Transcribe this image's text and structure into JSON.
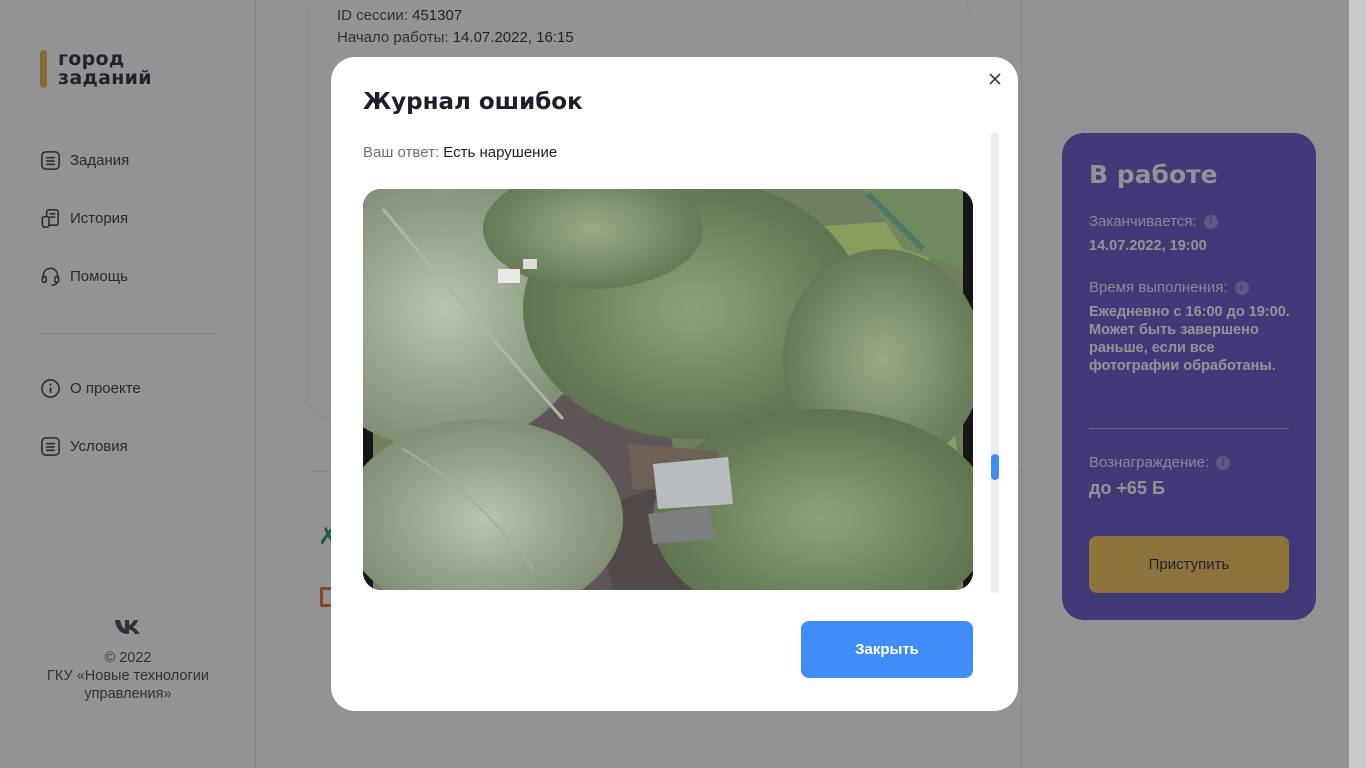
{
  "brand": {
    "logo_line1": "город",
    "logo_line2": "заданий",
    "accent": "#e0b23f"
  },
  "sidebar": {
    "items": [
      {
        "label": "Задания",
        "icon": "list-icon"
      },
      {
        "label": "История",
        "icon": "history-icon"
      },
      {
        "label": "Помощь",
        "icon": "headset-icon"
      },
      {
        "label": "О проекте",
        "icon": "info-icon"
      },
      {
        "label": "Условия",
        "icon": "list-icon"
      }
    ],
    "footer": {
      "copyright": "© 2022",
      "org_line1": "ГКУ «Новые технологии",
      "org_line2": "управления»",
      "social_icon": "vk-icon"
    }
  },
  "session": {
    "id_label": "ID сессии:",
    "id_value": "451307",
    "start_label": "Начало работы:",
    "start_value": "14.07.2022, 16:15"
  },
  "status_card": {
    "title": "В работе",
    "ends_label": "Заканчивается:",
    "ends_value": "14.07.2022, 19:00",
    "time_label": "Время выполнения:",
    "time_value": "Ежедневно с 16:00 до 19:00. Может быть завершено раньше, если все фотографии обработаны.",
    "reward_label": "Вознаграждение:",
    "reward_value": "до +65 Б",
    "start_button": "Приступить",
    "bg_color": "#5d4bc4",
    "button_color": "#f3c14a"
  },
  "modal": {
    "title": "Журнал ошибок",
    "answer_label": "Ваш ответ:",
    "answer_value": "Есть нарушение",
    "photo_alt": "aerial-camera-photo",
    "close_button": "Закрыть",
    "button_color": "#3f8ef8"
  }
}
